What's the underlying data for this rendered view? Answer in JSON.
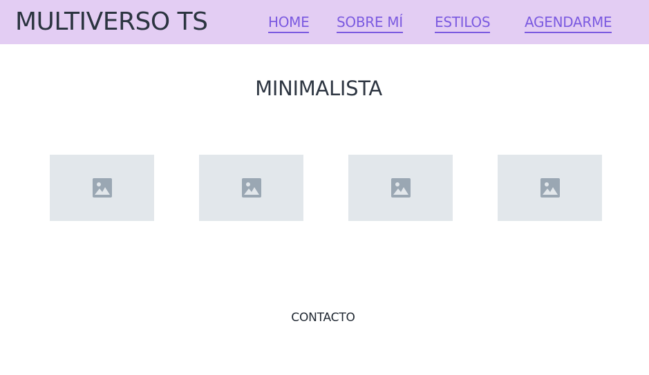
{
  "header": {
    "brand": "MULTIVERSO TS",
    "nav": [
      {
        "label": "HOME"
      },
      {
        "label": "SOBRE MÍ"
      },
      {
        "label": "ESTILOS"
      },
      {
        "label": "AGENDARME"
      }
    ]
  },
  "main": {
    "title": "MINIMALISTA",
    "gallery": [
      {
        "icon": "image-placeholder-icon"
      },
      {
        "icon": "image-placeholder-icon"
      },
      {
        "icon": "image-placeholder-icon"
      },
      {
        "icon": "image-placeholder-icon"
      }
    ]
  },
  "footer": {
    "contact": "CONTACTO"
  },
  "colors": {
    "header_bg": "#e3cdf3",
    "nav_link": "#7b5ae0",
    "text": "#2b3440",
    "placeholder_bg": "#e2e7eb",
    "placeholder_icon": "#9aa7b3"
  }
}
